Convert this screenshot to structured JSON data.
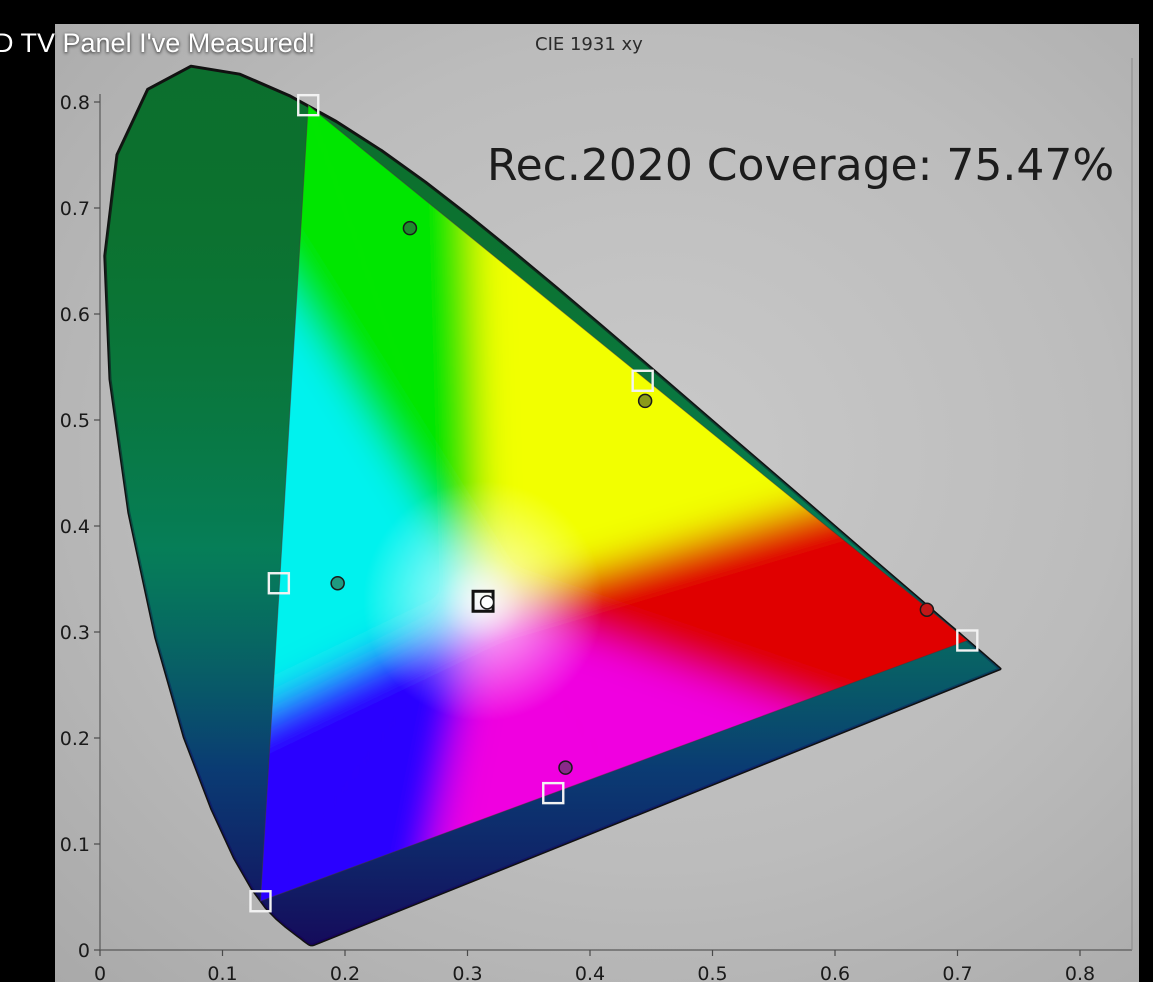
{
  "video": {
    "title_overlay": "D TV Panel I've Measured!"
  },
  "chart_data": {
    "type": "scatter",
    "title": "CIE 1931 xy",
    "annotation": "Rec.2020 Coverage: 75.47%",
    "xlim": [
      0,
      0.8
    ],
    "ylim": [
      0,
      0.8
    ],
    "x_ticks": [
      "0",
      "0.1",
      "0.2",
      "0.3",
      "0.4",
      "0.5",
      "0.6",
      "0.7",
      "0.8"
    ],
    "y_ticks": [
      "0",
      "0.1",
      "0.2",
      "0.3",
      "0.4",
      "0.5",
      "0.6",
      "0.7",
      "0.8"
    ],
    "grid": false,
    "target_gamut": [
      {
        "x": 0.708,
        "y": 0.292
      },
      {
        "x": 0.17,
        "y": 0.797
      },
      {
        "x": 0.131,
        "y": 0.046
      }
    ],
    "series": [
      {
        "markers": "squares",
        "points": [
          {
            "x": 0.708,
            "y": 0.292
          },
          {
            "x": 0.17,
            "y": 0.797
          },
          {
            "x": 0.131,
            "y": 0.046
          },
          {
            "x": 0.443,
            "y": 0.537
          },
          {
            "x": 0.146,
            "y": 0.346
          },
          {
            "x": 0.37,
            "y": 0.148
          },
          {
            "x": 0.3127,
            "y": 0.329
          }
        ]
      },
      {
        "markers": "circles",
        "points": [
          {
            "x": 0.675,
            "y": 0.321,
            "color": "#c21818"
          },
          {
            "x": 0.253,
            "y": 0.681,
            "color": "#1f8a2e"
          },
          {
            "x": 0.445,
            "y": 0.518,
            "color": "#8a9a1a"
          },
          {
            "x": 0.194,
            "y": 0.346,
            "color": "#1f9a80"
          },
          {
            "x": 0.38,
            "y": 0.172,
            "color": "#8a2a8a"
          },
          {
            "x": 0.316,
            "y": 0.328,
            "color": "#ffffff"
          }
        ]
      }
    ],
    "colors": {
      "red": "#e00000",
      "green": "#00e600",
      "blue": "#2a00ff",
      "yellow": "#f2ff00",
      "cyan": "#00f2ee",
      "magenta": "#f000e0",
      "white": "#ffffff",
      "locus_fill": "#0c6f2e",
      "locus_stroke": "#111111"
    }
  }
}
